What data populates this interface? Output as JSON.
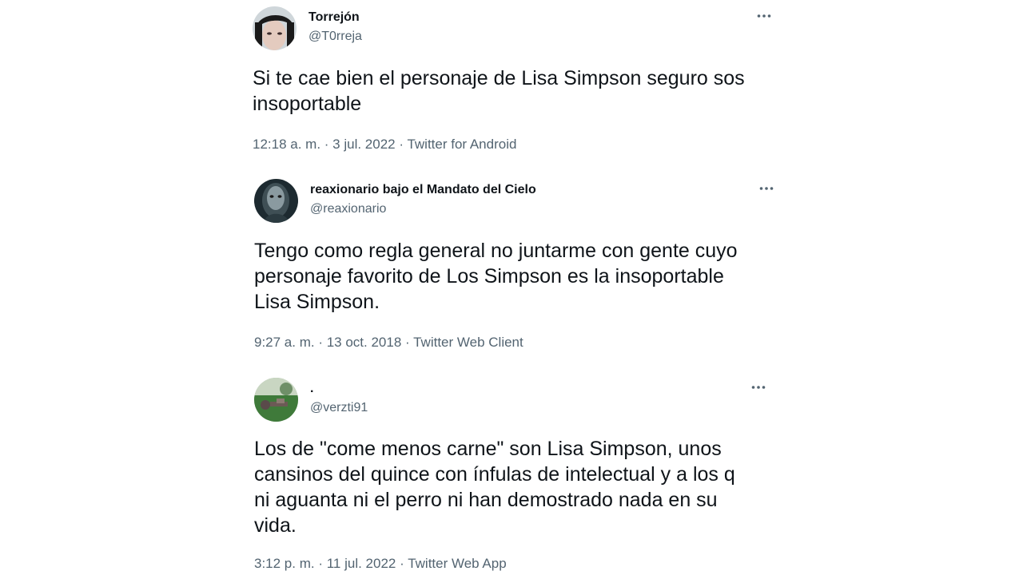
{
  "tweets": [
    {
      "display_name": "Torrejón",
      "handle": "@T0rreja",
      "text": "Si te cae bien el personaje de Lisa Simpson seguro sos\ninsoportable",
      "time": "12:18 a. m.",
      "date": "3 jul. 2022",
      "source": "Twitter for Android",
      "more_icon": "more-horizontal-icon"
    },
    {
      "display_name": "reaxionario bajo el Mandato del Cielo",
      "handle": "@reaxionario",
      "text": "Tengo como regla general no juntarme con gente cuyo\npersonaje favorito de Los Simpson es la insoportable\nLisa Simpson.",
      "time": "9:27 a. m.",
      "date": "13 oct. 2018",
      "source": "Twitter Web Client",
      "more_icon": "more-horizontal-icon"
    },
    {
      "display_name": ".",
      "handle": "@verzti91",
      "text": "Los de \"come menos carne\" son Lisa Simpson, unos\ncansinos del quince con ínfulas de intelectual y a los q\nni aguanta ni el perro ni han demostrado nada en su\nvida.",
      "time": "3:12 p. m.",
      "date": "11 jul. 2022",
      "source": "Twitter Web App",
      "more_icon": "more-horizontal-icon"
    }
  ],
  "separator": " · ",
  "colors": {
    "text": "#0f1419",
    "secondary": "#536471",
    "background": "#ffffff"
  }
}
